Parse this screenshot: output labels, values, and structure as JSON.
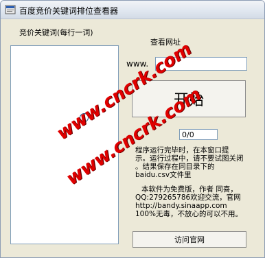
{
  "window": {
    "title": "百度竞价关键词排位查看器"
  },
  "left_panel": {
    "header": "竞价关键词(每行一词)"
  },
  "right_panel": {
    "url_header": "查看网址",
    "url_prefix": "www.",
    "url_value": "",
    "start_button": "开始",
    "progress": "0/0",
    "instructions": [
      "程序运行完毕时，在本窗口提",
      "示。运行过程中，请不要试图关闭",
      "。结果保存在同目录下的",
      "baidu.csv文件里"
    ],
    "author_info": [
      "本软件为免费版，作者 同喜，",
      "QQ:279265786欢迎交流，官网",
      "http://bandy.sinaapp.com",
      "100%无毒，不放心的可以不用。"
    ],
    "visit_button": "访问官网"
  },
  "watermarks": [
    "www.cncrk.com",
    "www.cncrk.com"
  ],
  "colors": {
    "window_bg": "#ece9d8",
    "watermark": "#e00000"
  }
}
